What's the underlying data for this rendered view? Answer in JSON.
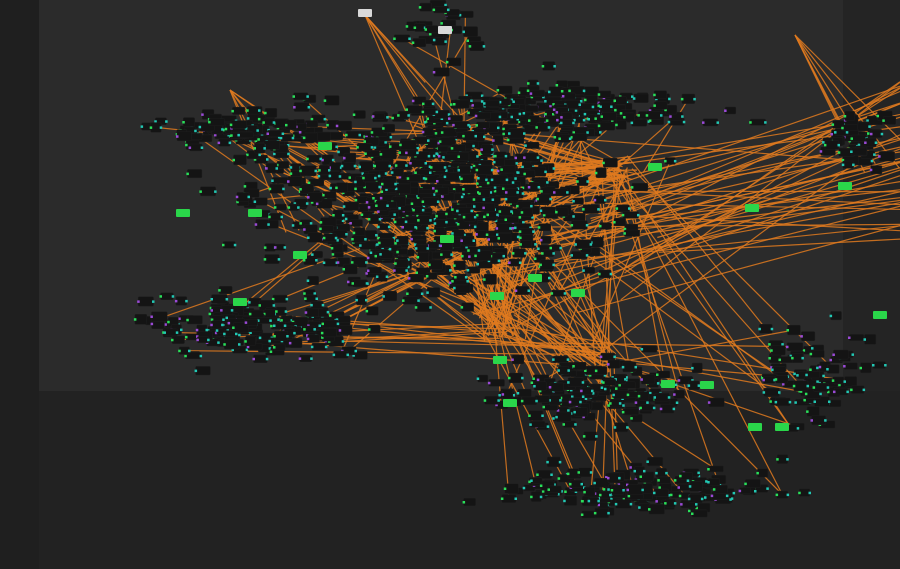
{
  "app": {
    "view": "node-graph-editor",
    "theme": "dark"
  },
  "colors": {
    "background": "#1f1f1f",
    "panel": "#2b2b2b",
    "node": "#141414",
    "edge": "#e07a1f",
    "pin_green": "#29e05a",
    "pin_cyan": "#22c8b4",
    "pin_purple": "#9a4ad6",
    "badge": "#2ad64a"
  },
  "graph": {
    "description_visible": false,
    "zoom_state": "zoomed-out"
  }
}
